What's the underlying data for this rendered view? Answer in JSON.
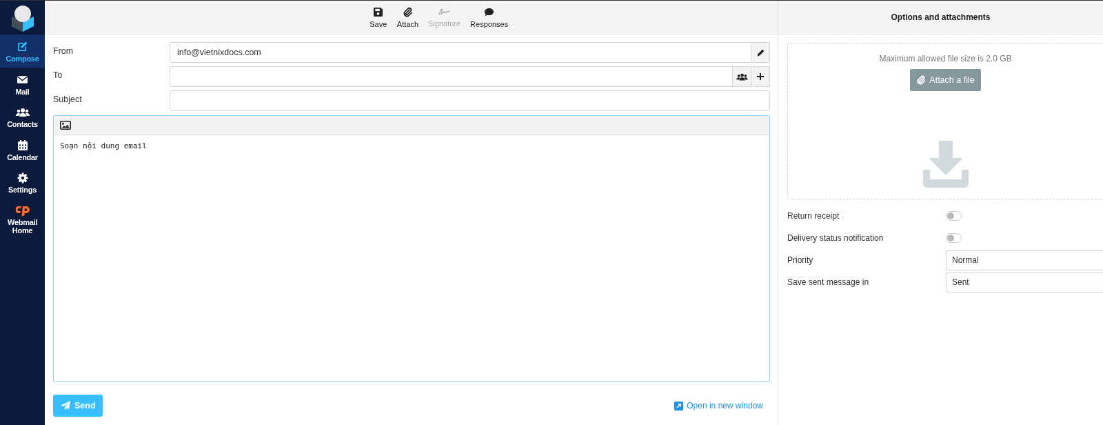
{
  "sidebar": {
    "items": [
      {
        "kind": "compose",
        "label": "Compose",
        "selected": true
      },
      {
        "kind": "mail",
        "label": "Mail",
        "selected": false
      },
      {
        "kind": "contacts",
        "label": "Contacts",
        "selected": false
      },
      {
        "kind": "calendar",
        "label": "Calendar",
        "selected": false
      },
      {
        "kind": "settings",
        "label": "Settings",
        "selected": false
      },
      {
        "kind": "cpanel",
        "label": "Webmail Home",
        "selected": false
      }
    ]
  },
  "toolbar": {
    "items": [
      {
        "kind": "save",
        "label": "Save",
        "disabled": false
      },
      {
        "kind": "attach",
        "label": "Attach",
        "disabled": false
      },
      {
        "kind": "signature",
        "label": "Signature",
        "disabled": true
      },
      {
        "kind": "responses",
        "label": "Responses",
        "disabled": false
      }
    ]
  },
  "fields": [
    {
      "kind": "from",
      "label": "From",
      "value": "info@vietnixdocs.com"
    },
    {
      "kind": "to",
      "label": "To"
    },
    {
      "kind": "subject",
      "label": "Subject"
    }
  ],
  "editor": {
    "value": "Soạn nội dung email"
  },
  "send_button": "Send",
  "open_new_window": "Open in new window",
  "options": {
    "title": "Options and attachments",
    "max_size": "Maximum allowed file size is 2.0 GB",
    "attach_button": "Attach a file",
    "toggles": [
      {
        "label": "Return receipt",
        "on": false
      },
      {
        "label": "Delivery status notification",
        "on": false
      }
    ],
    "selects": [
      {
        "label": "Priority",
        "value": "Normal"
      },
      {
        "label": "Save sent message in",
        "value": "Sent"
      }
    ]
  }
}
